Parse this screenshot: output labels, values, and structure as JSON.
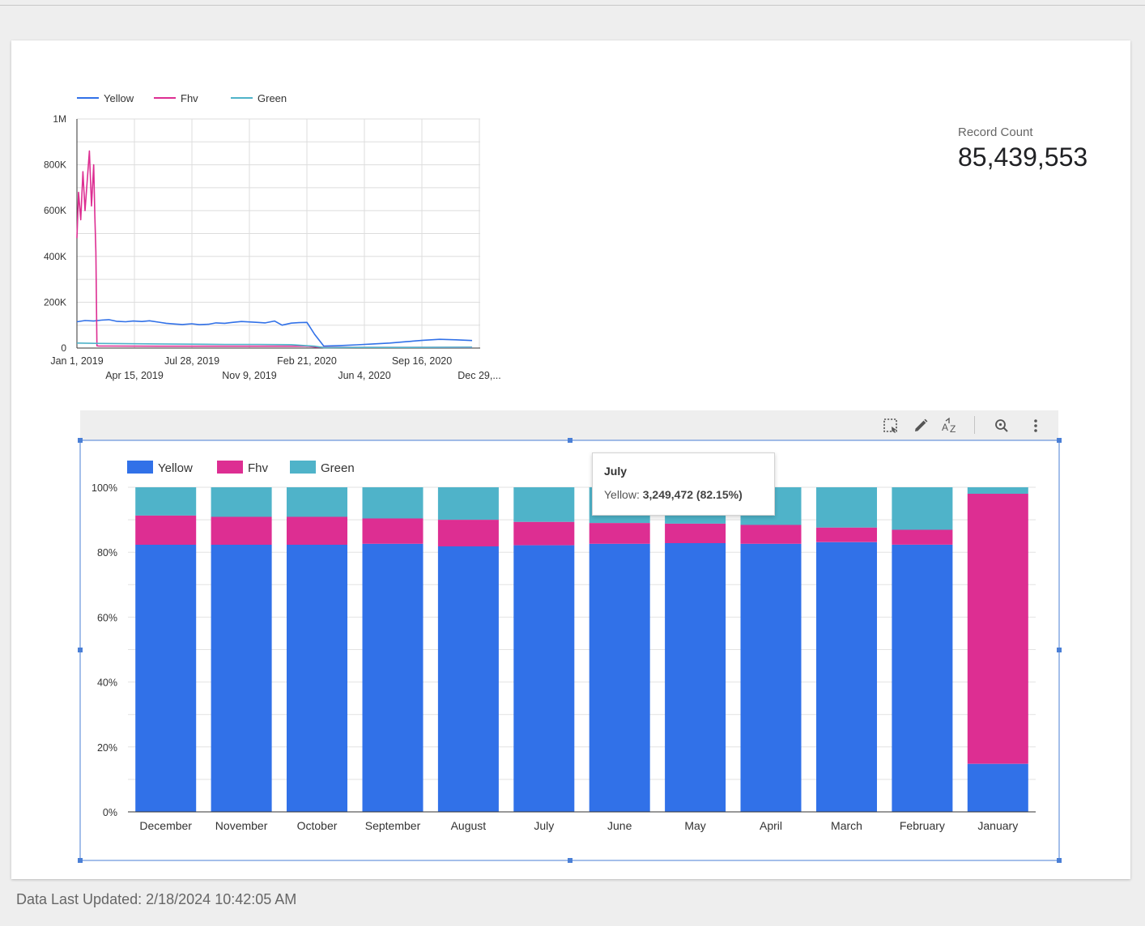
{
  "footer": {
    "prefix": "Data Last Updated: ",
    "timestamp": "2/18/2024 10:42:05 AM"
  },
  "scorecard": {
    "label": "Record Count",
    "value": "85,439,553"
  },
  "colors": {
    "yellow": "#3171e8",
    "fhv": "#dd2e92",
    "green": "#4fb3c9",
    "selection": "#4a7fd6"
  },
  "toolbar": {
    "icons": [
      "select-area-icon",
      "pencil-icon",
      "sort-az-icon",
      "zoom-icon",
      "more-vert-icon"
    ]
  },
  "tooltip": {
    "title": "July",
    "series": "Yellow",
    "value": "3,249,472 (82.15%)"
  },
  "chart_data": [
    {
      "type": "line",
      "title": "",
      "legend_position": "top-left",
      "grid": true,
      "legend": [
        "Yellow",
        "Fhv",
        "Green"
      ],
      "xlim": [
        "Jan 1, 2019",
        "Jan 15, 2021"
      ],
      "x_tick_labels": [
        "Jan 1, 2019",
        "Apr 15, 2019",
        "Jul 28, 2019",
        "Nov 9, 2019",
        "Feb 21, 2020",
        "Jun 4, 2020",
        "Sep 16, 2020",
        "Dec 29,..."
      ],
      "ylim": [
        0,
        1000000
      ],
      "y_tick_labels": [
        "0",
        "200K",
        "400K",
        "600K",
        "800K",
        "1M"
      ],
      "series": [
        {
          "name": "Yellow",
          "x": [
            "2019-01-01",
            "2019-01-16",
            "2019-02-01",
            "2019-02-15",
            "2019-03-01",
            "2019-03-15",
            "2019-04-01",
            "2019-04-15",
            "2019-05-01",
            "2019-05-15",
            "2019-06-01",
            "2019-06-15",
            "2019-07-01",
            "2019-07-15",
            "2019-08-01",
            "2019-08-15",
            "2019-09-01",
            "2019-09-15",
            "2019-10-01",
            "2019-10-15",
            "2019-11-01",
            "2019-11-15",
            "2019-12-01",
            "2019-12-15",
            "2020-01-01",
            "2020-01-15",
            "2020-02-01",
            "2020-02-15",
            "2020-03-01",
            "2020-03-15",
            "2020-04-01",
            "2020-05-01",
            "2020-06-01",
            "2020-07-01",
            "2020-08-01",
            "2020-09-01",
            "2020-10-01",
            "2020-11-01",
            "2020-12-01",
            "2020-12-31"
          ],
          "y": [
            115000,
            120000,
            118000,
            122000,
            124000,
            117000,
            115000,
            118000,
            116000,
            119000,
            113000,
            108000,
            105000,
            103000,
            106000,
            102000,
            104000,
            110000,
            108000,
            112000,
            116000,
            114000,
            112000,
            110000,
            118000,
            100000,
            109000,
            111000,
            112000,
            60000,
            9000,
            11000,
            14000,
            18000,
            22000,
            28000,
            34000,
            38000,
            36000,
            33000
          ]
        },
        {
          "name": "Fhv",
          "x": [
            "2019-01-01",
            "2019-01-04",
            "2019-01-08",
            "2019-01-12",
            "2019-01-16",
            "2019-01-20",
            "2019-01-24",
            "2019-01-28",
            "2019-02-01",
            "2019-02-03",
            "2019-02-05",
            "2019-02-07",
            "2019-02-10",
            "2019-03-01",
            "2019-06-01",
            "2019-09-01",
            "2019-12-01",
            "2020-03-01",
            "2020-03-20",
            "2020-06-01",
            "2020-09-01",
            "2020-12-31"
          ],
          "y": [
            480000,
            680000,
            560000,
            770000,
            600000,
            730000,
            860000,
            620000,
            800000,
            580000,
            420000,
            10000,
            9000,
            9000,
            8000,
            8000,
            8000,
            8000,
            4000,
            3000,
            3000,
            3000
          ]
        },
        {
          "name": "Green",
          "x": [
            "2019-01-01",
            "2019-02-15",
            "2019-04-01",
            "2019-06-01",
            "2019-08-01",
            "2019-10-01",
            "2019-12-01",
            "2020-02-01",
            "2020-03-15",
            "2020-04-01",
            "2020-06-01",
            "2020-09-01",
            "2020-12-31"
          ],
          "y": [
            22000,
            20000,
            19000,
            18000,
            17000,
            16000,
            16000,
            15000,
            8000,
            2000,
            3000,
            3000,
            4000
          ]
        }
      ]
    },
    {
      "type": "bar",
      "stacked": true,
      "percent_stacked": true,
      "title": "",
      "legend_position": "top-left",
      "grid": true,
      "legend": [
        "Yellow",
        "Fhv",
        "Green"
      ],
      "categories": [
        "December",
        "November",
        "October",
        "September",
        "August",
        "July",
        "June",
        "May",
        "April",
        "March",
        "February",
        "January"
      ],
      "ylim": [
        0,
        100
      ],
      "y_tick_labels": [
        "0%",
        "20%",
        "40%",
        "60%",
        "80%",
        "100%"
      ],
      "series": [
        {
          "name": "Yellow",
          "values": [
            82.3,
            82.3,
            82.3,
            82.6,
            81.8,
            82.15,
            82.6,
            82.8,
            82.6,
            83.1,
            82.3,
            14.8
          ]
        },
        {
          "name": "Fhv",
          "values": [
            9.0,
            8.6,
            8.6,
            7.8,
            8.2,
            7.2,
            6.4,
            6.0,
            5.8,
            4.5,
            4.6,
            83.2
          ]
        },
        {
          "name": "Green",
          "values": [
            8.7,
            9.1,
            9.1,
            9.6,
            10.0,
            10.65,
            11.0,
            11.2,
            11.6,
            12.4,
            13.1,
            2.0
          ]
        }
      ]
    }
  ]
}
